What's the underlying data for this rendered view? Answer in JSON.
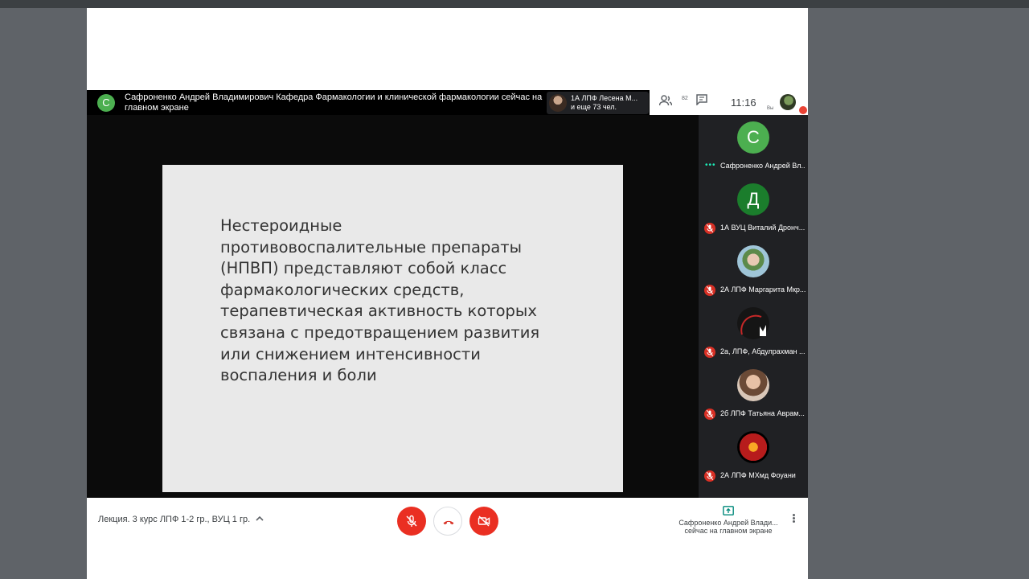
{
  "header": {
    "presenter_initial": "С",
    "presenting_text": "Сафроненко Андрей Владимирович Кафедра Фармакологии и клинической фармакологии сейчас на главном экране",
    "chip_line1": "1А ЛПФ Лесена М...",
    "chip_line2": "и еще 73 чел.",
    "people_count": "82",
    "clock": "11:16",
    "you_label": "Вы"
  },
  "slide": {
    "text": "Нестероидные противовоспалительные препараты (НПВП) представляют собой класс фармакологических средств, терапевтическая активность которых связана с предотвращением развития или снижением интенсивности воспаления и боли"
  },
  "sidebar": {
    "tiles": [
      {
        "initial": "С",
        "name": "Сафроненко Андрей Вл...",
        "color": "#4caf50",
        "status": "speaking"
      },
      {
        "initial": "Д",
        "name": "1А ВУЦ Виталий Дронч...",
        "color": "#1b7d2c",
        "status": "muted"
      },
      {
        "initial": "",
        "name": "2А ЛПФ Маргарита Мкр...",
        "color": "#8fb8c9",
        "status": "muted"
      },
      {
        "initial": "",
        "name": "2а, ЛПФ, Абдулрахман ...",
        "color": "#1a1a1a",
        "status": "muted"
      },
      {
        "initial": "",
        "name": "2б ЛПФ Татьяна Аврам...",
        "color": "#c9a58b",
        "status": "muted"
      },
      {
        "initial": "",
        "name": "2А ЛПФ МХмд Фоуани",
        "color": "#b71c1c",
        "status": "muted"
      }
    ]
  },
  "bottom": {
    "meeting_title": "Лекция. 3 курс ЛПФ 1-2 гр., ВУЦ 1 гр.",
    "present_line1": "Сафроненко Андрей Влади...",
    "present_line2": "сейчас на главном экране"
  },
  "colors": {
    "accent_red": "#ea2f22",
    "speaking_green": "#1de9b6"
  }
}
